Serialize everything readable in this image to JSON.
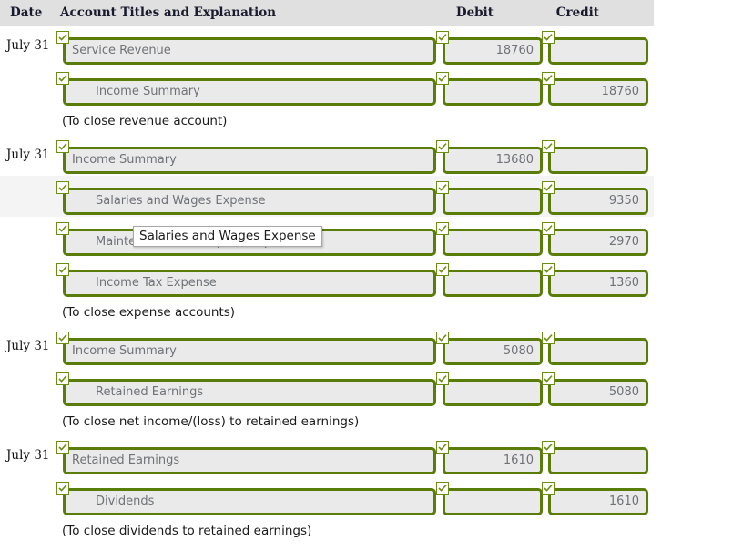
{
  "header": {
    "date": "Date",
    "account": "Account Titles and Explanation",
    "debit": "Debit",
    "credit": "Credit"
  },
  "colors": {
    "field_border": "#5a7d0a",
    "field_fill": "#eaeaea",
    "header_fill": "#e0e0e0",
    "row_highlight": "#f4f4f4",
    "checkbox_border": "#6b8e12",
    "check_mark": "#6b8e12",
    "field_text": "#6f7277"
  },
  "tooltip": {
    "visible": true,
    "text": "Salaries and Wages Expense"
  },
  "rows": [
    {
      "type": "entry",
      "date": "July 31",
      "account": "Service Revenue",
      "indent": false,
      "debit": "18760",
      "credit": "",
      "checked": true,
      "highlight": false
    },
    {
      "type": "entry",
      "date": "",
      "account": "Income Summary",
      "indent": true,
      "debit": "",
      "credit": "18760",
      "checked": true,
      "highlight": false
    },
    {
      "type": "caption",
      "text": "(To close revenue account)"
    },
    {
      "type": "entry",
      "date": "July 31",
      "account": "Income Summary",
      "indent": false,
      "debit": "13680",
      "credit": "",
      "checked": true,
      "highlight": false
    },
    {
      "type": "entry",
      "date": "",
      "account": "Salaries and Wages Expense",
      "indent": true,
      "debit": "",
      "credit": "9350",
      "checked": true,
      "highlight": true
    },
    {
      "type": "entry",
      "date": "",
      "account": "Maintenance and Repairs Expense",
      "indent": true,
      "debit": "",
      "credit": "2970",
      "checked": true,
      "highlight": false
    },
    {
      "type": "entry",
      "date": "",
      "account": "Income Tax Expense",
      "indent": true,
      "debit": "",
      "credit": "1360",
      "checked": true,
      "highlight": false
    },
    {
      "type": "caption",
      "text": "(To close expense accounts)"
    },
    {
      "type": "entry",
      "date": "July 31",
      "account": "Income Summary",
      "indent": false,
      "debit": "5080",
      "credit": "",
      "checked": true,
      "highlight": false
    },
    {
      "type": "entry",
      "date": "",
      "account": "Retained Earnings",
      "indent": true,
      "debit": "",
      "credit": "5080",
      "checked": true,
      "highlight": false
    },
    {
      "type": "caption",
      "text": "(To close net income/(loss) to retained earnings)"
    },
    {
      "type": "entry",
      "date": "July 31",
      "account": "Retained Earnings",
      "indent": false,
      "debit": "1610",
      "credit": "",
      "checked": true,
      "highlight": false
    },
    {
      "type": "entry",
      "date": "",
      "account": "Dividends",
      "indent": true,
      "debit": "",
      "credit": "1610",
      "checked": true,
      "highlight": false
    },
    {
      "type": "caption",
      "text": "(To close dividends to retained earnings)"
    }
  ]
}
